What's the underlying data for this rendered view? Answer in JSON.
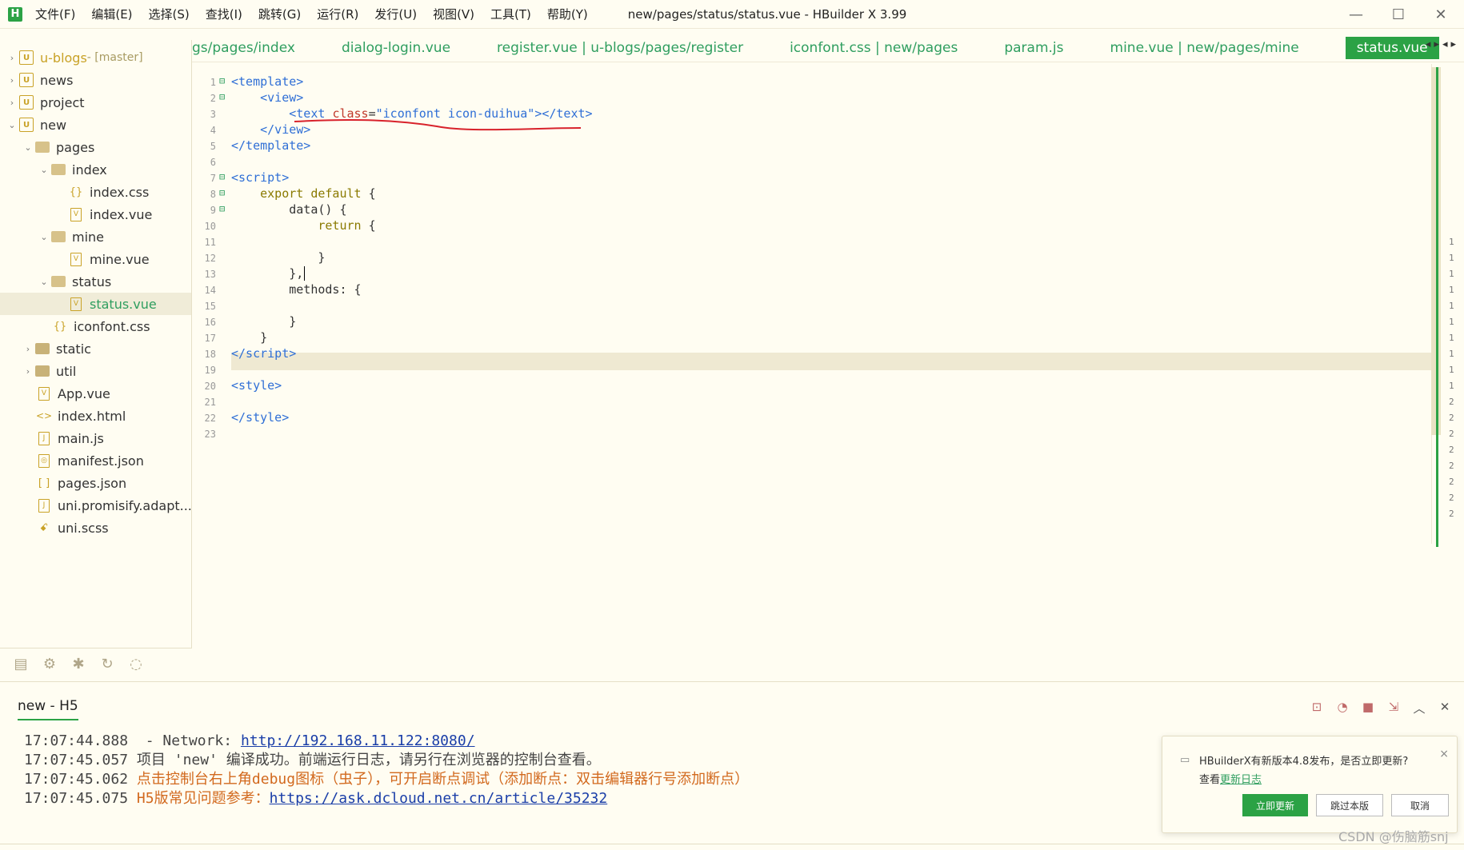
{
  "titlebar": {
    "logo": "H",
    "menus": [
      "文件(F)",
      "编辑(E)",
      "选择(S)",
      "查找(I)",
      "跳转(G)",
      "运行(R)",
      "发行(U)",
      "视图(V)",
      "工具(T)",
      "帮助(Y)"
    ],
    "title": "new/pages/status/status.vue - HBuilder X 3.99",
    "minimize": "—",
    "maximize": "☐",
    "close": "✕"
  },
  "sidebar": {
    "items": [
      {
        "label": "u-blogs",
        "suffix": " - [master]"
      },
      {
        "label": "news"
      },
      {
        "label": "project"
      },
      {
        "label": "new"
      },
      {
        "label": "pages"
      },
      {
        "label": "index"
      },
      {
        "label": "index.css"
      },
      {
        "label": "index.vue"
      },
      {
        "label": "mine"
      },
      {
        "label": "mine.vue"
      },
      {
        "label": "status"
      },
      {
        "label": "status.vue"
      },
      {
        "label": "iconfont.css"
      },
      {
        "label": "static"
      },
      {
        "label": "util"
      },
      {
        "label": "App.vue"
      },
      {
        "label": "index.html"
      },
      {
        "label": "main.js"
      },
      {
        "label": "manifest.json"
      },
      {
        "label": "pages.json"
      },
      {
        "label": "uni.promisify.adapt..."
      },
      {
        "label": "uni.scss"
      }
    ]
  },
  "tabs": [
    "gs/pages/index",
    "dialog-login.vue",
    "register.vue | u-blogs/pages/register",
    "iconfont.css | new/pages",
    "param.js",
    "mine.vue | new/pages/mine",
    "status.vue"
  ],
  "editor": {
    "lines": [
      "1",
      "2",
      "3",
      "4",
      "5",
      "6",
      "7",
      "8",
      "9",
      "10",
      "11",
      "12",
      "13",
      "14",
      "15",
      "16",
      "17",
      "18",
      "19",
      "20",
      "21",
      "22",
      "23"
    ]
  },
  "minimap": [
    "1",
    "1",
    "1",
    "1",
    "1",
    "1",
    "1",
    "1",
    "1",
    "1",
    "2",
    "2",
    "2",
    "2",
    "2",
    "2",
    "2",
    "2"
  ],
  "console": {
    "tab_label": "new - H5",
    "lines": [
      {
        "time": "17:07:44.888",
        "text": "  - Network: ",
        "link": "http://192.168.11.122:8080/"
      },
      {
        "time": "17:07:45.057",
        "text": "项目 'new' 编译成功。前端运行日志，请另行在浏览器的控制台查看。"
      },
      {
        "time": "17:07:45.062",
        "text": "点击控制台右上角debug图标（虫子），可开启断点调试（添加断点：双击编辑器行号添加断点）"
      },
      {
        "time": "17:07:45.075",
        "text": "H5版常见问题参考：",
        "link": "https://ask.dcloud.net.cn/article/35232"
      }
    ]
  },
  "notification": {
    "message": "HBuilderX有新版本4.8发布，是否立即更新?",
    "view_prefix": "查看",
    "view_link": "更新日志",
    "update": "立即更新",
    "skip": "跳过本版",
    "cancel": "取消",
    "close": "×"
  },
  "watermark": "CSDN @伤脑筋snj"
}
